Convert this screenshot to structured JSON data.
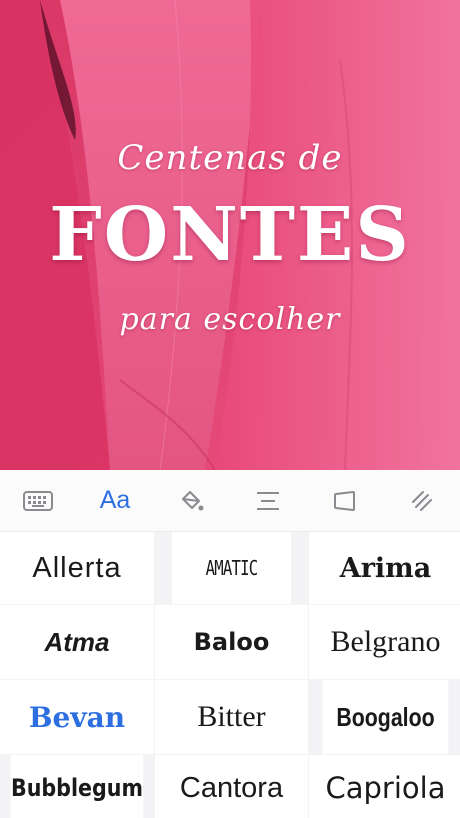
{
  "hero": {
    "line1": "Centenas de",
    "line2": "FONTES",
    "line3": "para escolher"
  },
  "toolbar": {
    "items": [
      {
        "icon": "keyboard-icon"
      },
      {
        "icon": "font-icon",
        "label": "Aa",
        "active": true
      },
      {
        "icon": "color-fill-icon"
      },
      {
        "icon": "align-center-icon"
      },
      {
        "icon": "shape-icon"
      },
      {
        "icon": "opacity-icon"
      }
    ],
    "active_color": "#2d6fe0"
  },
  "fonts": [
    {
      "name": "Allerta"
    },
    {
      "name": "AMATIC"
    },
    {
      "name": "Arima"
    },
    {
      "name": "Atma"
    },
    {
      "name": "Baloo"
    },
    {
      "name": "Belgrano"
    },
    {
      "name": "Bevan",
      "selected": true
    },
    {
      "name": "Bitter"
    },
    {
      "name": "Boogaloo"
    },
    {
      "name": "Bubblegum"
    },
    {
      "name": "Cantora"
    },
    {
      "name": "Capriola"
    }
  ],
  "colors": {
    "hero_pink": "#e84f7c",
    "selected_font": "#2d6fe0",
    "toolbar_icon": "#8a8a90"
  }
}
